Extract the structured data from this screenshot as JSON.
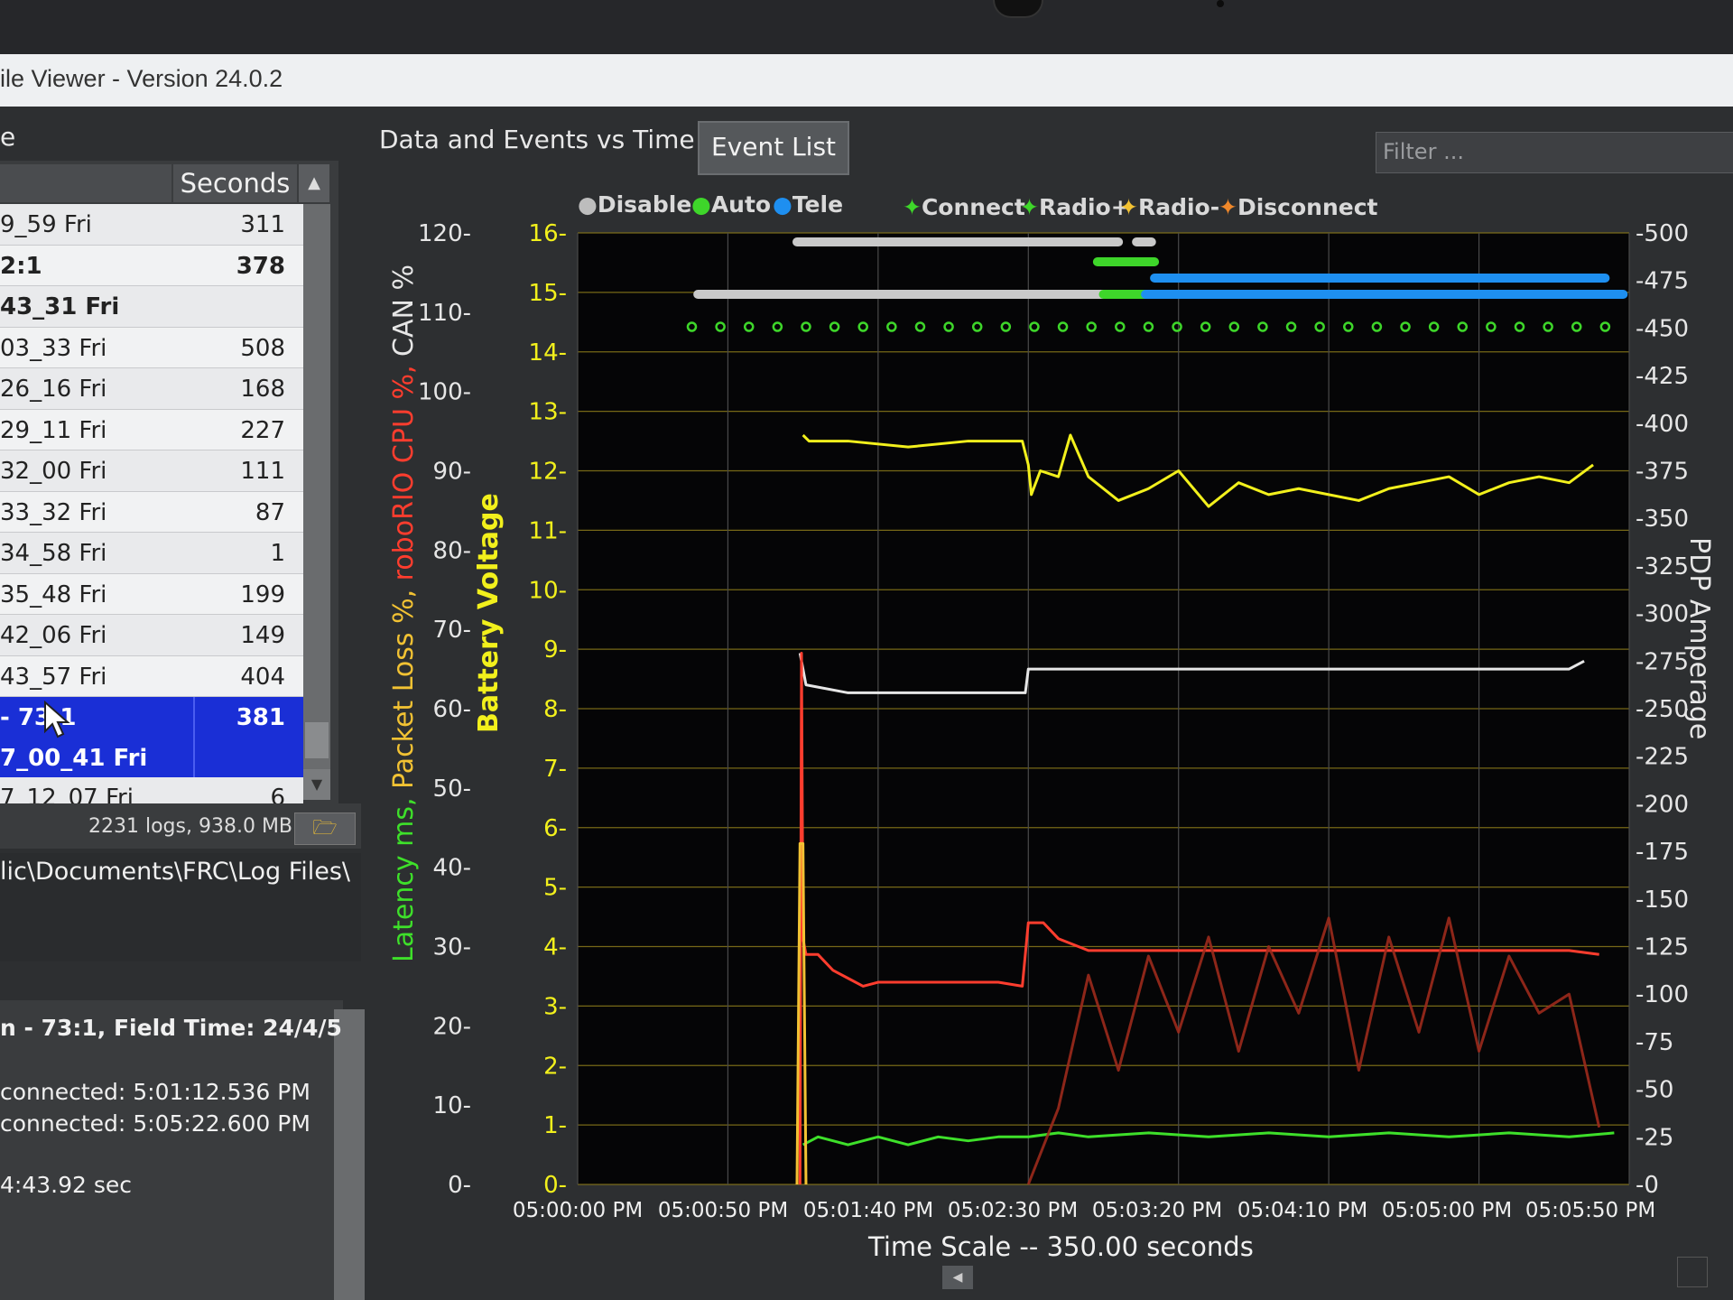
{
  "window": {
    "title": "ile Viewer - Version 24.0.2"
  },
  "left_panel": {
    "header": "e",
    "columns": {
      "seconds": "Seconds"
    },
    "rows": [
      {
        "name": "9_59 Fri",
        "seconds": "311"
      },
      {
        "name": "2:1",
        "seconds": "378"
      },
      {
        "name": "43_31 Fri",
        "seconds": ""
      },
      {
        "name": "03_33 Fri",
        "seconds": "508"
      },
      {
        "name": "26_16 Fri",
        "seconds": "168"
      },
      {
        "name": "29_11 Fri",
        "seconds": "227"
      },
      {
        "name": "32_00 Fri",
        "seconds": "111"
      },
      {
        "name": "33_32 Fri",
        "seconds": "87"
      },
      {
        "name": "34_58 Fri",
        "seconds": "1"
      },
      {
        "name": "35_48 Fri",
        "seconds": "199"
      },
      {
        "name": "42_06 Fri",
        "seconds": "149"
      },
      {
        "name": "43_57 Fri",
        "seconds": "404"
      },
      {
        "name": "- 73:1",
        "seconds": "381"
      },
      {
        "name": "7_00_41 Fri",
        "seconds": ""
      },
      {
        "name": "7_12_07 Fri",
        "seconds": "6"
      }
    ],
    "logs_summary": "2231 logs, 938.0 MB",
    "path": "lic\\Documents\\FRC\\Log Files\\",
    "info": {
      "match_line": "n - 73:1, Field Time: 24/4/5",
      "connected_1": "connected:  5:01:12.536 PM",
      "connected_2": "connected:  5:05:22.600 PM",
      "duration": "4:43.92 sec"
    }
  },
  "tabs": [
    {
      "label": "Data and Events vs Time",
      "active": true
    },
    {
      "label": "Event List",
      "active": false
    }
  ],
  "filter": {
    "placeholder": "Filter ..."
  },
  "legend": {
    "disable": "Disable",
    "auto": "Auto",
    "tele": "Tele",
    "connect": "Connect",
    "radio_plus": "Radio+",
    "radio_minus": "Radio-",
    "disconnect": "Disconnect"
  },
  "colors": {
    "battery": "#f2f01c",
    "cpu": "#ff3d2e",
    "can": "#e6e6e6",
    "latency": "#3ee02a",
    "packet_loss": "#f2c233",
    "pdp": "#9c2a1c",
    "auto": "#3ed62a",
    "tele": "#1e8ff0",
    "disable": "#c9c9c9"
  },
  "chart_data": {
    "type": "line",
    "xlabel": "Time Scale -- 350.00 seconds",
    "x_ticks": [
      "05:00:00 PM",
      "05:00:50 PM",
      "05:01:40 PM",
      "05:02:30 PM",
      "05:03:20 PM",
      "05:04:10 PM",
      "05:05:00 PM",
      "05:05:50 PM"
    ],
    "x_range_seconds": [
      0,
      350
    ],
    "axes": {
      "left_outer": {
        "title_parts": [
          "Latency ms, ",
          "Packet Loss %, ",
          "roboRIO CPU %, ",
          "CAN %"
        ],
        "ticks": [
          "120",
          "110",
          "100",
          "90",
          "80",
          "70",
          "60",
          "50",
          "40",
          "30",
          "20",
          "10",
          "0"
        ],
        "ylim": [
          0,
          120
        ]
      },
      "left_inner": {
        "title": "Battery Voltage",
        "ticks": [
          "16",
          "15",
          "14",
          "13",
          "12",
          "11",
          "10",
          "9",
          "8",
          "7",
          "6",
          "5",
          "4",
          "3",
          "2",
          "1",
          "0"
        ],
        "ylim": [
          0,
          16
        ]
      },
      "right": {
        "title": "PDP Amperage",
        "ticks": [
          "500",
          "475",
          "450",
          "425",
          "400",
          "375",
          "350",
          "325",
          "300",
          "275",
          "250",
          "225",
          "200",
          "175",
          "150",
          "125",
          "100",
          "75",
          "50",
          "25",
          "0"
        ],
        "ylim": [
          0,
          500
        ]
      }
    },
    "series": [
      {
        "name": "Battery Voltage",
        "axis": "left_inner",
        "points": [
          [
            75,
            12.6
          ],
          [
            77,
            12.5
          ],
          [
            90,
            12.5
          ],
          [
            110,
            12.4
          ],
          [
            130,
            12.5
          ],
          [
            148,
            12.5
          ],
          [
            150,
            12.1
          ],
          [
            151,
            11.6
          ],
          [
            154,
            12.0
          ],
          [
            160,
            11.9
          ],
          [
            164,
            12.6
          ],
          [
            170,
            11.9
          ],
          [
            180,
            11.5
          ],
          [
            190,
            11.7
          ],
          [
            200,
            12.0
          ],
          [
            210,
            11.4
          ],
          [
            220,
            11.8
          ],
          [
            230,
            11.6
          ],
          [
            240,
            11.7
          ],
          [
            250,
            11.6
          ],
          [
            260,
            11.5
          ],
          [
            270,
            11.7
          ],
          [
            280,
            11.8
          ],
          [
            290,
            11.9
          ],
          [
            300,
            11.6
          ],
          [
            310,
            11.8
          ],
          [
            320,
            11.9
          ],
          [
            330,
            11.8
          ],
          [
            338,
            12.1
          ]
        ]
      },
      {
        "name": "CAN %",
        "axis": "left_outer",
        "points": [
          [
            74,
            67
          ],
          [
            76,
            63
          ],
          [
            90,
            62
          ],
          [
            100,
            62
          ],
          [
            120,
            62
          ],
          [
            140,
            62
          ],
          [
            149,
            62
          ],
          [
            150,
            65
          ],
          [
            170,
            65
          ],
          [
            190,
            65
          ],
          [
            210,
            65
          ],
          [
            230,
            65
          ],
          [
            250,
            65
          ],
          [
            270,
            65
          ],
          [
            290,
            65
          ],
          [
            310,
            65
          ],
          [
            330,
            65
          ],
          [
            335,
            66
          ]
        ]
      },
      {
        "name": "roboRIO CPU %",
        "axis": "left_outer",
        "points": [
          [
            74,
            0
          ],
          [
            74.5,
            67
          ],
          [
            75,
            31
          ],
          [
            76,
            29
          ],
          [
            80,
            29
          ],
          [
            85,
            27
          ],
          [
            90,
            26
          ],
          [
            95,
            25
          ],
          [
            100,
            25.5
          ],
          [
            120,
            25.5
          ],
          [
            140,
            25.5
          ],
          [
            148,
            25
          ],
          [
            150,
            33
          ],
          [
            155,
            33
          ],
          [
            160,
            31
          ],
          [
            170,
            29.5
          ],
          [
            190,
            29.5
          ],
          [
            210,
            29.5
          ],
          [
            230,
            29.5
          ],
          [
            250,
            29.5
          ],
          [
            270,
            29.5
          ],
          [
            290,
            29.5
          ],
          [
            310,
            29.5
          ],
          [
            330,
            29.5
          ],
          [
            340,
            29
          ]
        ]
      },
      {
        "name": "Latency ms",
        "axis": "left_outer",
        "points": [
          [
            75,
            5
          ],
          [
            80,
            6
          ],
          [
            90,
            5
          ],
          [
            100,
            6
          ],
          [
            110,
            5
          ],
          [
            120,
            6
          ],
          [
            130,
            5.5
          ],
          [
            140,
            6
          ],
          [
            150,
            6
          ],
          [
            160,
            6.5
          ],
          [
            170,
            6
          ],
          [
            190,
            6.5
          ],
          [
            210,
            6
          ],
          [
            230,
            6.5
          ],
          [
            250,
            6
          ],
          [
            270,
            6.5
          ],
          [
            290,
            6
          ],
          [
            310,
            6.5
          ],
          [
            330,
            6
          ],
          [
            345,
            6.5
          ]
        ]
      },
      {
        "name": "Packet Loss %",
        "axis": "left_outer",
        "points": [
          [
            73,
            0
          ],
          [
            74,
            43
          ],
          [
            75,
            43
          ],
          [
            76,
            0
          ]
        ]
      },
      {
        "name": "PDP Amperage",
        "axis": "right",
        "points": [
          [
            150,
            0
          ],
          [
            160,
            40
          ],
          [
            170,
            110
          ],
          [
            180,
            60
          ],
          [
            190,
            120
          ],
          [
            200,
            80
          ],
          [
            210,
            130
          ],
          [
            220,
            70
          ],
          [
            230,
            125
          ],
          [
            240,
            90
          ],
          [
            250,
            140
          ],
          [
            260,
            60
          ],
          [
            270,
            130
          ],
          [
            280,
            80
          ],
          [
            290,
            140
          ],
          [
            300,
            70
          ],
          [
            310,
            120
          ],
          [
            320,
            90
          ],
          [
            330,
            100
          ],
          [
            340,
            30
          ]
        ]
      }
    ],
    "mode_bars": [
      {
        "mode": "Disable",
        "start": 73,
        "end": 180
      },
      {
        "mode": "Disable",
        "start": 186,
        "end": 191
      },
      {
        "mode": "Auto",
        "start": 173,
        "end": 192
      },
      {
        "mode": "Tele",
        "start": 192,
        "end": 342
      },
      {
        "mode": "Disable",
        "start": 40,
        "end": 175
      },
      {
        "mode": "Auto",
        "start": 175,
        "end": 189
      },
      {
        "mode": "Tele",
        "start": 189,
        "end": 348
      }
    ],
    "grid": true
  }
}
